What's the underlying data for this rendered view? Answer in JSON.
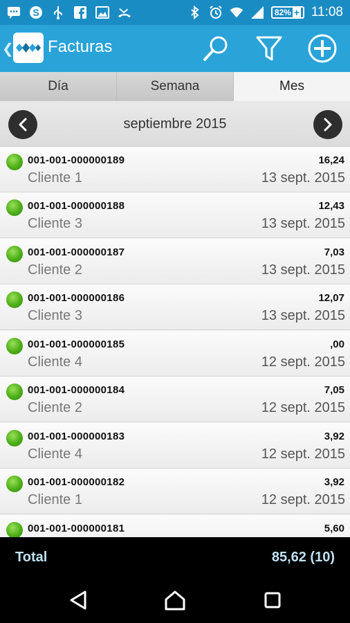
{
  "status_bar": {
    "battery_percent": "82%",
    "time": "11:08",
    "left_icons": [
      "message-icon",
      "skype-icon",
      "usb-icon",
      "facebook-icon",
      "image-icon",
      "missed-call-icon"
    ],
    "right_icons": [
      "bluetooth-icon",
      "alarm-icon",
      "wifi-icon",
      "signal-icon",
      "battery-icon"
    ]
  },
  "app_bar": {
    "title": "Facturas",
    "actions": [
      "search-icon",
      "filter-icon",
      "add-icon"
    ]
  },
  "tabs": [
    {
      "label": "Día",
      "active": false
    },
    {
      "label": "Semana",
      "active": false
    },
    {
      "label": "Mes",
      "active": true
    }
  ],
  "period": {
    "label": "septiembre 2015"
  },
  "invoices": [
    {
      "number": "001-001-000000189",
      "client": "Cliente 1",
      "amount": "16,24",
      "date": "13 sept. 2015",
      "status_color": "#4cae17"
    },
    {
      "number": "001-001-000000188",
      "client": "Cliente 3",
      "amount": "12,43",
      "date": "13 sept. 2015",
      "status_color": "#4cae17"
    },
    {
      "number": "001-001-000000187",
      "client": "Cliente 2",
      "amount": "7,03",
      "date": "13 sept. 2015",
      "status_color": "#4cae17"
    },
    {
      "number": "001-001-000000186",
      "client": "Cliente 3",
      "amount": "12,07",
      "date": "13 sept. 2015",
      "status_color": "#4cae17"
    },
    {
      "number": "001-001-000000185",
      "client": "Cliente 4",
      "amount": ",00",
      "date": "12 sept. 2015",
      "status_color": "#4cae17"
    },
    {
      "number": "001-001-000000184",
      "client": "Cliente 2",
      "amount": "7,05",
      "date": "12 sept. 2015",
      "status_color": "#4cae17"
    },
    {
      "number": "001-001-000000183",
      "client": "Cliente 4",
      "amount": "3,92",
      "date": "12 sept. 2015",
      "status_color": "#4cae17"
    },
    {
      "number": "001-001-000000182",
      "client": "Cliente 1",
      "amount": "3,92",
      "date": "12 sept. 2015",
      "status_color": "#4cae17"
    },
    {
      "number": "001-001-000000181",
      "client": "",
      "amount": "5,60",
      "date": "",
      "status_color": "#4cae17"
    }
  ],
  "footer": {
    "total_label": "Total",
    "total_value": "85,62 (10)"
  },
  "colors": {
    "status_bar": "#1a8cc4",
    "app_bar": "#29a3d8",
    "total_text": "#bfe2f2"
  },
  "nav_bar": [
    "back-icon",
    "home-icon",
    "recents-icon"
  ]
}
